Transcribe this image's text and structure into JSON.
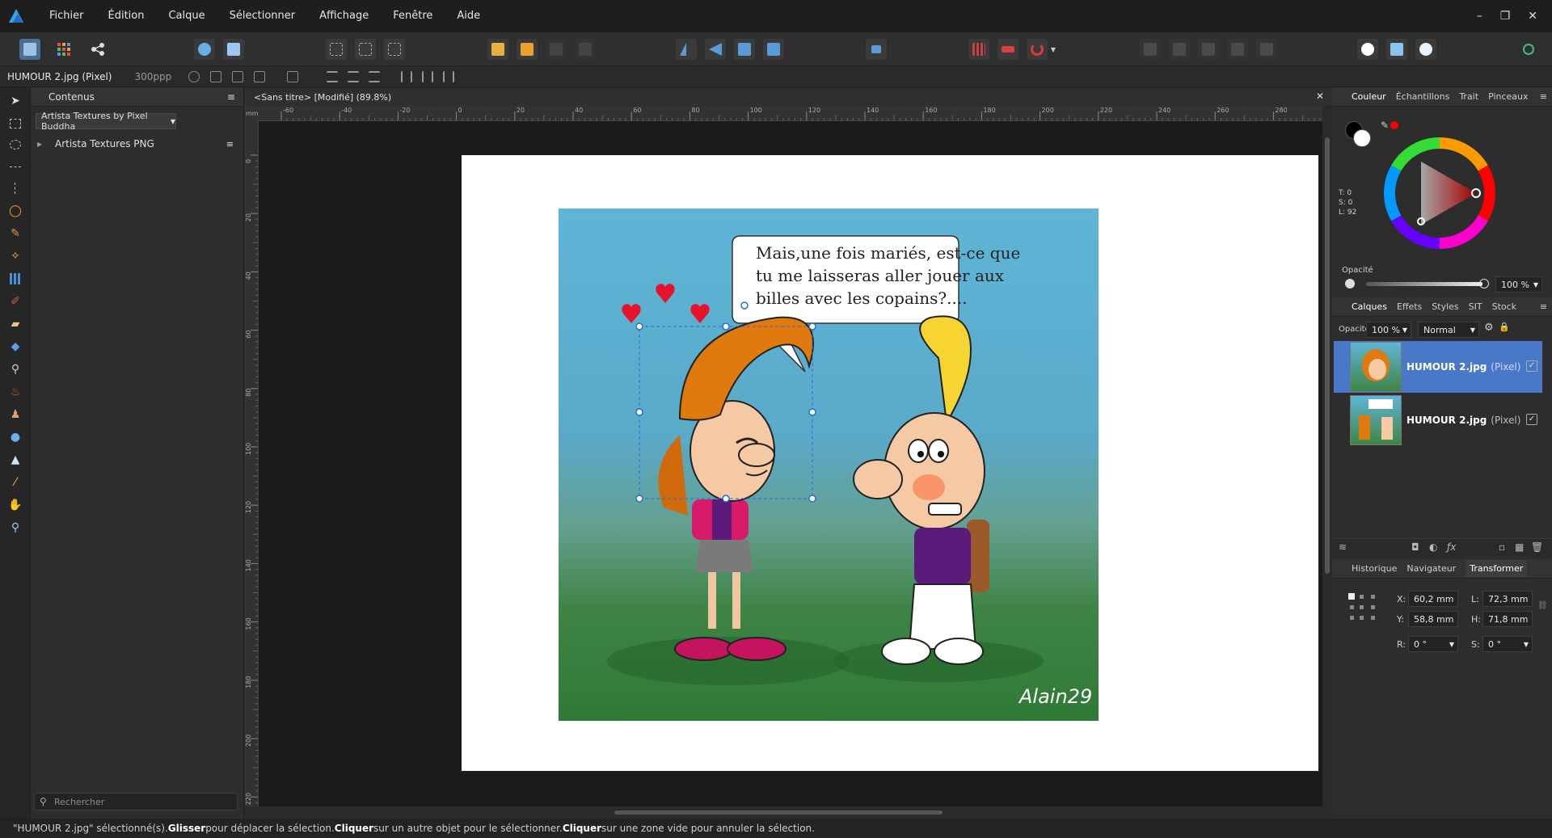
{
  "menu": {
    "items": [
      "Fichier",
      "Édition",
      "Calque",
      "Sélectionner",
      "Affichage",
      "Fenêtre",
      "Aide"
    ],
    "window_controls": [
      "–",
      "❐",
      "✕"
    ]
  },
  "context_bar": {
    "doc_label": "HUMOUR 2.jpg (Pixel)",
    "dpi": "300ppp"
  },
  "left_panel": {
    "tab": "Contenus",
    "collection": "Artista Textures by Pixel Buddha",
    "items": [
      "Artista Textures PNG"
    ],
    "search_placeholder": "Rechercher"
  },
  "document": {
    "tab_title": "<Sans titre> [Modifié] (89.8%)",
    "ruler_unit": "mm",
    "hruler_ticks": [
      "-60",
      "-40",
      "-20",
      "0",
      "20",
      "40",
      "60",
      "80",
      "100",
      "120",
      "140",
      "160",
      "180",
      "200",
      "220",
      "240",
      "260",
      "280"
    ],
    "vruler_ticks": [
      "0",
      "20",
      "40",
      "60",
      "80",
      "100",
      "120",
      "140",
      "160",
      "180",
      "200",
      "220"
    ],
    "speech_bubble": [
      "Mais,une fois mariés, est-ce que",
      "tu me laisseras aller jouer aux",
      "billes avec les copains?...."
    ],
    "signature": "Alain29"
  },
  "right_panel": {
    "color_tabs": [
      "Couleur",
      "Échantillons",
      "Trait",
      "Pinceaux"
    ],
    "color_values": {
      "t": "T: 0",
      "s": "S: 0",
      "l": "L: 92"
    },
    "opacity_label": "Opacité",
    "opacity_value": "100 %",
    "layers_tabs": [
      "Calques",
      "Effets",
      "Styles",
      "SIT",
      "Stock"
    ],
    "layers_opacity_label": "Opacité:",
    "layers_opacity": "100 %",
    "blend_mode": "Normal",
    "layers": [
      {
        "name": "HUMOUR  2.jpg",
        "type": "(Pixel)",
        "selected": true
      },
      {
        "name": "HUMOUR  2.jpg",
        "type": "(Pixel)",
        "selected": false
      }
    ],
    "transform_tabs": [
      "Historique",
      "Navigateur",
      "Transformer"
    ],
    "transform": {
      "x_label": "X:",
      "x": "60,2 mm",
      "y_label": "Y:",
      "y": "58,8 mm",
      "w_label": "L:",
      "w": "72,3 mm",
      "h_label": "H:",
      "h": "71,8 mm",
      "r_label": "R:",
      "r": "0 °",
      "s_label": "S:",
      "s": "0 °"
    }
  },
  "status": {
    "part1": "\"HUMOUR  2.jpg\" sélectionné(s). ",
    "b1": "Glisser",
    "part2": " pour déplacer la sélection. ",
    "b2": "Cliquer",
    "part3": " sur un autre objet pour le sélectionner. ",
    "b3": "Cliquer",
    "part4": " sur une zone vide pour annuler la sélection."
  },
  "colors": {
    "accent_blue": "#4a78c8",
    "brand": "#2f8fd8",
    "primary_swatch": "#000000",
    "secondary_swatch": "#ffffff",
    "pen_color": "#ff0000"
  }
}
